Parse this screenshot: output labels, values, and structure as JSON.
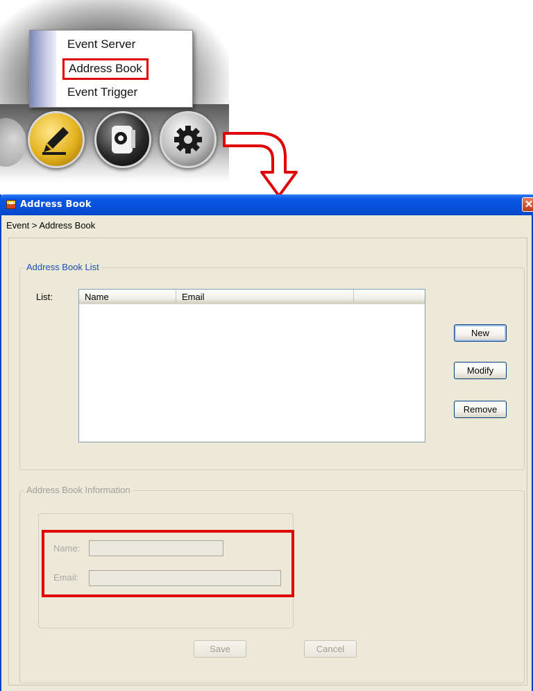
{
  "menu": {
    "items": [
      "Event Server",
      "Address Book",
      "Event Trigger"
    ],
    "selected_index": 1
  },
  "dock": {
    "buttons": [
      "pencil-icon",
      "camera-icon",
      "gear-icon"
    ]
  },
  "window": {
    "title": "Address Book",
    "close_symbol": "✕",
    "breadcrumb": "Event > Address Book"
  },
  "address_book_list": {
    "legend": "Address Book List",
    "list_label": "List:",
    "columns": [
      "Name",
      "Email"
    ],
    "rows": [],
    "buttons": {
      "new": "New",
      "modify": "Modify",
      "remove": "Remove"
    }
  },
  "address_book_information": {
    "legend": "Address Book Information",
    "name_label": "Name:",
    "email_label": "Email:",
    "name_value": "",
    "email_value": "",
    "buttons": {
      "save": "Save",
      "cancel": "Cancel"
    }
  },
  "colors": {
    "highlight": "#e00000",
    "titlebar": "#0750d9",
    "window_bg": "#ece9d8"
  }
}
